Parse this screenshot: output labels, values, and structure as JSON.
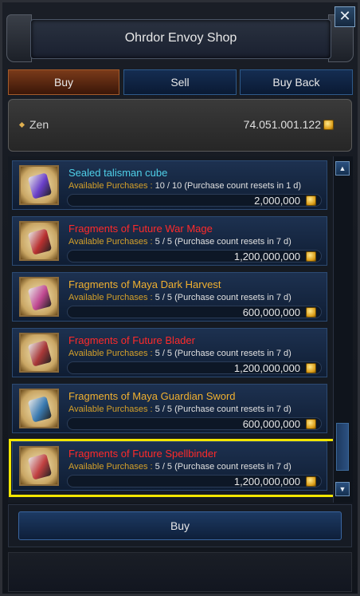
{
  "window": {
    "title": "Ohrdor Envoy Shop",
    "close_label": "✕"
  },
  "tabs": [
    {
      "label": "Buy",
      "active": true
    },
    {
      "label": "Sell",
      "active": false
    },
    {
      "label": "Buy Back",
      "active": false
    }
  ],
  "zen": {
    "label": "Zen",
    "value": "74.051.001.122",
    "icon": "zen-coin-icon"
  },
  "items": [
    {
      "name": "Sealed talisman cube",
      "name_color": "#4fd0e8",
      "avail_prefix": "Available Purchases : ",
      "avail_count": "10 / 10",
      "avail_suffix": " (Purchase count resets in 1 d)",
      "price": "2,000,000",
      "icon_color": "#6a3fc8"
    },
    {
      "name": "Fragments of Future War Mage",
      "name_color": "#ff2a2a",
      "avail_prefix": "Available Purchases : ",
      "avail_count": "5 / 5",
      "avail_suffix": " (Purchase count resets in 7 d)",
      "price": "1,200,000,000",
      "icon_color": "#b83030"
    },
    {
      "name": "Fragments of Maya Dark Harvest",
      "name_color": "#f0b030",
      "avail_prefix": "Available Purchases : ",
      "avail_count": "5 / 5",
      "avail_suffix": " (Purchase count resets in 7 d)",
      "price": "600,000,000",
      "icon_color": "#c04890"
    },
    {
      "name": "Fragments of Future Blader",
      "name_color": "#ff2a2a",
      "avail_prefix": "Available Purchases : ",
      "avail_count": "5 / 5",
      "avail_suffix": " (Purchase count resets in 7 d)",
      "price": "1,200,000,000",
      "icon_color": "#a83838"
    },
    {
      "name": "Fragments of Maya Guardian Sword",
      "name_color": "#f0b030",
      "avail_prefix": "Available Purchases : ",
      "avail_count": "5 / 5",
      "avail_suffix": " (Purchase count resets in 7 d)",
      "price": "600,000,000",
      "icon_color": "#3a7ab0"
    },
    {
      "name": "Fragments of Future Spellbinder",
      "name_color": "#ff2a2a",
      "avail_prefix": "Available Purchases : ",
      "avail_count": "5 / 5",
      "avail_suffix": " (Purchase count resets in 7 d)",
      "price": "1,200,000,000",
      "icon_color": "#c04040",
      "selected": true
    }
  ],
  "scrollbar": {
    "up_label": "▲",
    "down_label": "▼"
  },
  "footer": {
    "buy_label": "Buy"
  },
  "colors": {
    "highlight": "#f2e600",
    "avail_text": "#d4a02a"
  }
}
